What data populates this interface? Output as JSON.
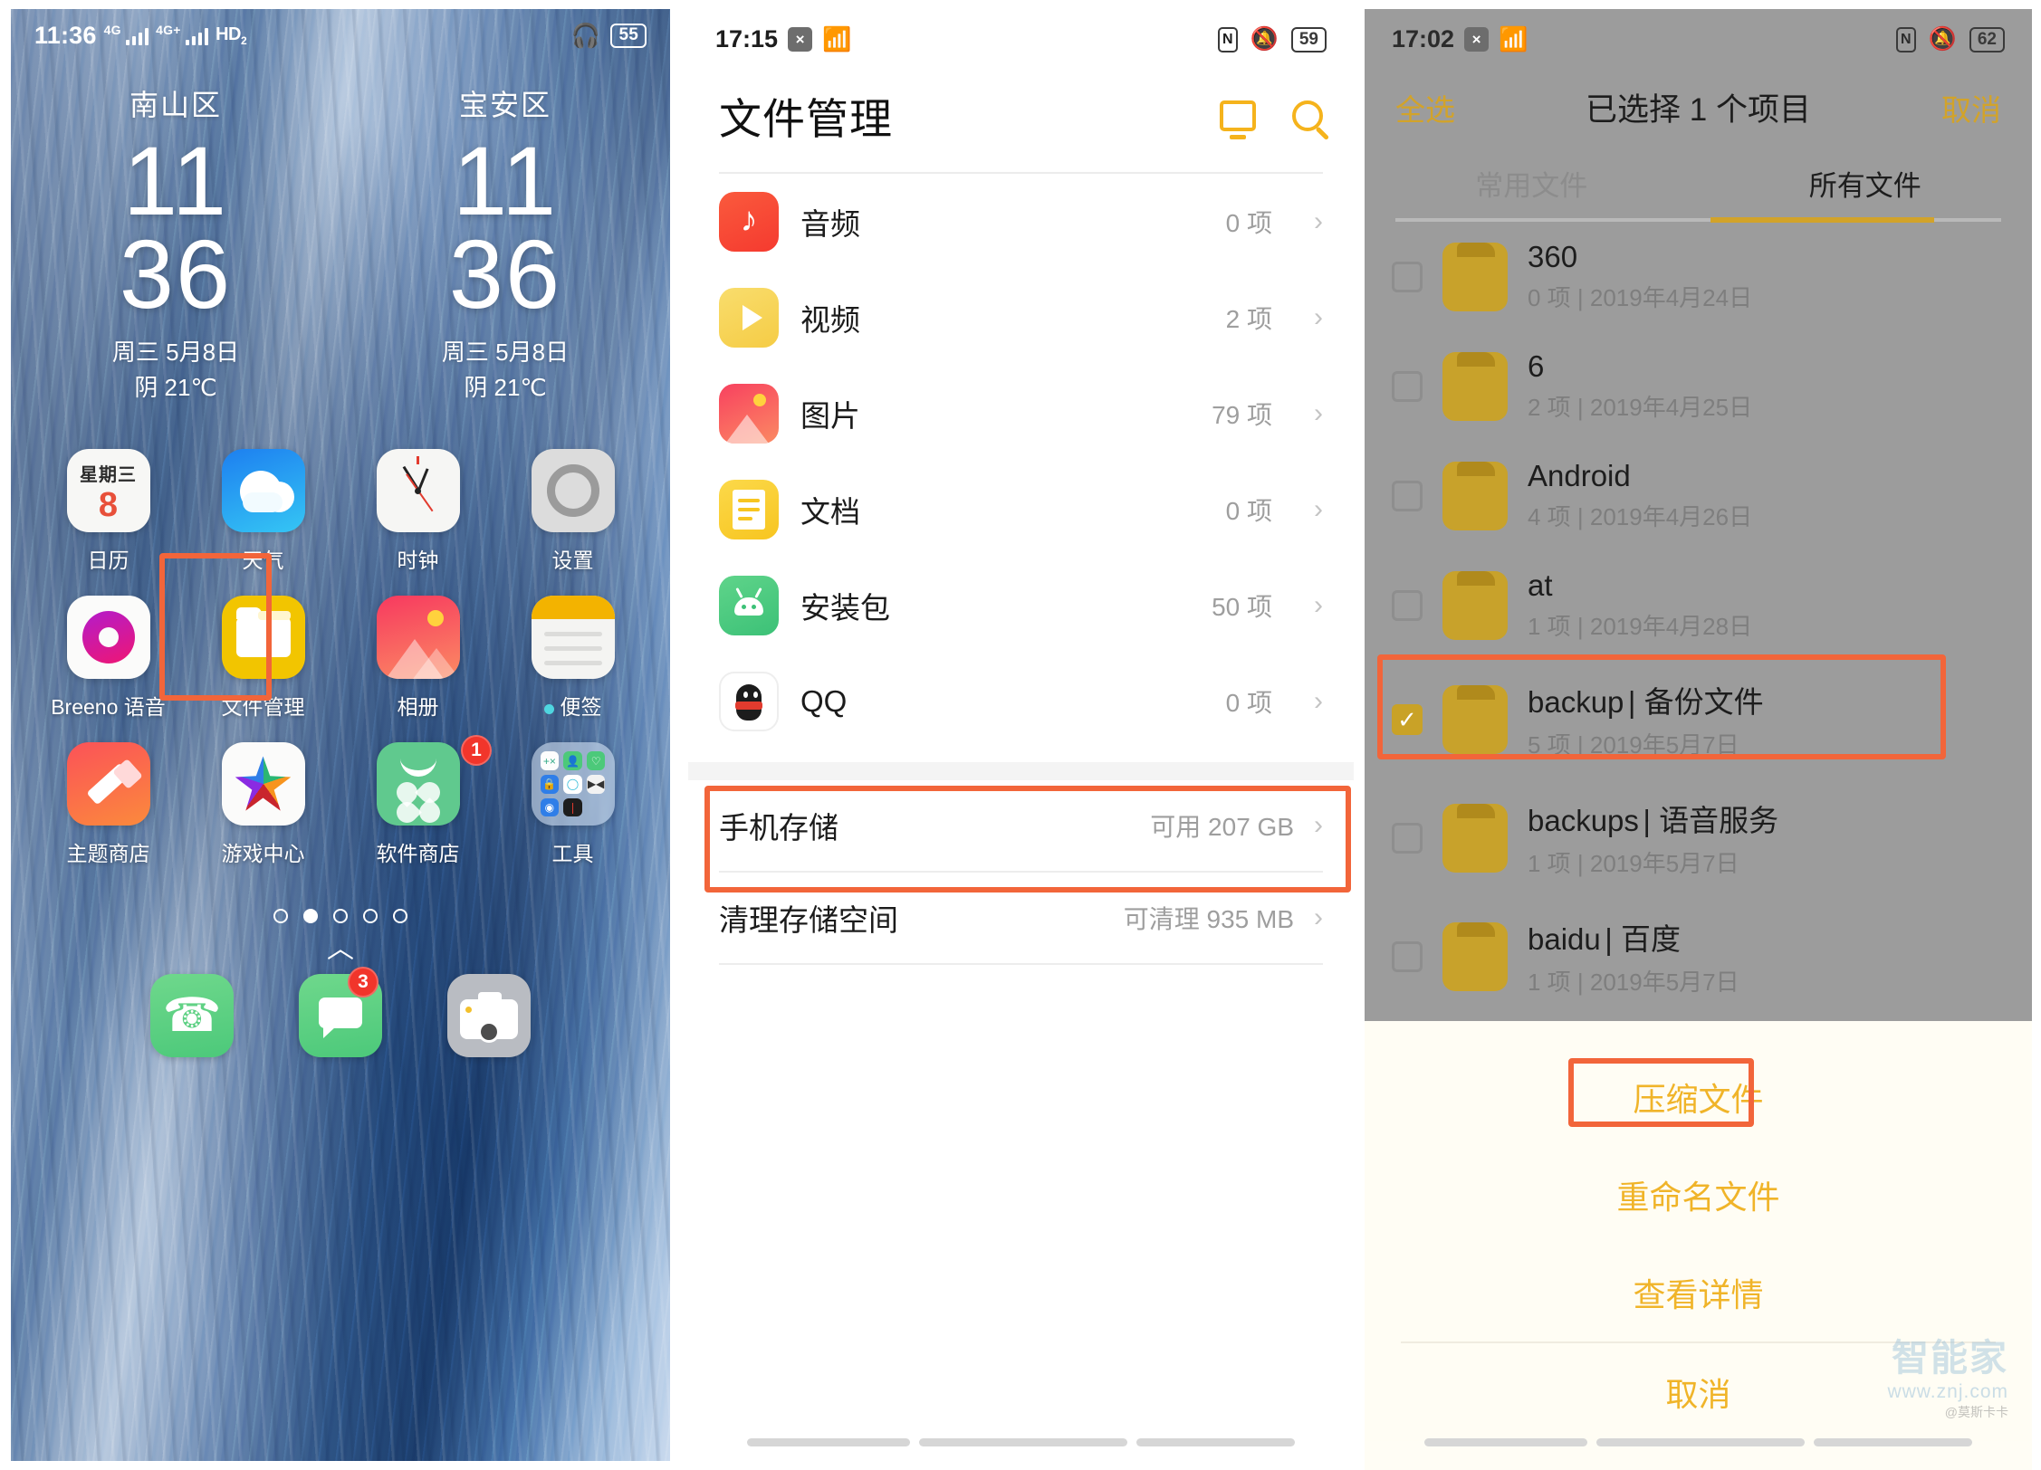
{
  "panel1": {
    "status_bar": {
      "time": "11:36",
      "signal_label_1": "4G",
      "signal_label_2": "4G+",
      "volte": "HD",
      "volte_sub": "2",
      "headset_icon": "headphones-icon",
      "battery": "55"
    },
    "clock_widgets": [
      {
        "city": "南山区",
        "hour": "11",
        "minute": "36",
        "date": "周三  5月8日",
        "weather": "阴 21℃"
      },
      {
        "city": "宝安区",
        "hour": "11",
        "minute": "36",
        "date": "周三  5月8日",
        "weather": "阴 21℃"
      }
    ],
    "apps": [
      {
        "label": "日历",
        "icon": "calendar-icon",
        "cal_weekday": "星期三",
        "cal_day": "8"
      },
      {
        "label": "天气",
        "icon": "weather-icon"
      },
      {
        "label": "时钟",
        "icon": "clock-icon"
      },
      {
        "label": "设置",
        "icon": "settings-gear-icon"
      },
      {
        "label": "Breeno 语音",
        "icon": "breeno-voice-icon"
      },
      {
        "label": "文件管理",
        "icon": "file-manager-folder-icon",
        "highlighted": true
      },
      {
        "label": "相册",
        "icon": "gallery-icon"
      },
      {
        "label": "便签",
        "icon": "notes-icon",
        "dot": true
      },
      {
        "label": "主题商店",
        "icon": "theme-store-brush-icon"
      },
      {
        "label": "游戏中心",
        "icon": "game-center-star-icon"
      },
      {
        "label": "软件商店",
        "icon": "app-store-icon",
        "badge": "1"
      },
      {
        "label": "工具",
        "icon": "tools-folder-icon"
      }
    ],
    "page_dots": {
      "count": 5,
      "active_index": 1
    },
    "up_chevron": "︿",
    "dock": [
      {
        "label": "电话",
        "icon": "phone-icon"
      },
      {
        "label": "信息",
        "icon": "messages-icon",
        "badge": "3"
      },
      {
        "label": "相机",
        "icon": "camera-icon"
      }
    ]
  },
  "panel2": {
    "status_bar": {
      "time": "17:15",
      "x_icon": "x-badge-icon",
      "wifi_icon": "wifi-icon",
      "nfc_icon": "nfc-icon",
      "nfc_label": "N",
      "mute_icon": "bell-mute-icon",
      "battery": "59"
    },
    "title": "文件管理",
    "actions": {
      "monitor_icon": "remote-display-icon",
      "search_icon": "search-icon"
    },
    "categories": [
      {
        "name": "音频",
        "count": "0 项",
        "icon": "audio-icon",
        "chevron": "chevron-right-icon"
      },
      {
        "name": "视频",
        "count": "2 项",
        "icon": "video-icon",
        "chevron": "chevron-right-icon"
      },
      {
        "name": "图片",
        "count": "79 项",
        "icon": "image-icon",
        "chevron": "chevron-right-icon"
      },
      {
        "name": "文档",
        "count": "0 项",
        "icon": "document-icon",
        "chevron": "chevron-right-icon"
      },
      {
        "name": "安装包",
        "count": "50 项",
        "icon": "apk-android-icon",
        "chevron": "chevron-right-icon"
      },
      {
        "name": "QQ",
        "count": "0 项",
        "icon": "qq-penguin-icon",
        "chevron": "chevron-right-icon"
      }
    ],
    "storage_row": {
      "name": "手机存储",
      "value": "可用 207 GB",
      "highlighted": true,
      "chevron": "chevron-right-icon"
    },
    "clean_row": {
      "name": "清理存储空间",
      "value": "可清理 935 MB",
      "chevron": "chevron-right-icon"
    }
  },
  "panel3": {
    "status_bar": {
      "time": "17:02",
      "x_icon": "x-badge-icon",
      "wifi_icon": "wifi-icon",
      "nfc_label": "N",
      "mute_icon": "bell-mute-icon",
      "battery": "62"
    },
    "select_all": "全选",
    "selection_title": "已选择 1 个项目",
    "cancel": "取消",
    "tabs": [
      {
        "label": "常用文件",
        "active": false
      },
      {
        "label": "所有文件",
        "active": true
      }
    ],
    "folders": [
      {
        "name": "360",
        "alias": "",
        "meta": "0 项 | 2019年4月24日",
        "checked": false,
        "highlighted": false
      },
      {
        "name": "6",
        "alias": "",
        "meta": "2 项 | 2019年4月25日",
        "checked": false,
        "highlighted": false
      },
      {
        "name": "Android",
        "alias": "",
        "meta": "4 项 | 2019年4月26日",
        "checked": false,
        "highlighted": false
      },
      {
        "name": "at",
        "alias": "",
        "meta": "1 项 | 2019年4月28日",
        "checked": false,
        "highlighted": false
      },
      {
        "name": "backup",
        "alias": "| 备份文件",
        "meta": "5 项 | 2019年5月7日",
        "checked": true,
        "highlighted": true
      },
      {
        "name": "backups",
        "alias": "| 语音服务",
        "meta": "1 项 | 2019年5月7日",
        "checked": false,
        "highlighted": false
      },
      {
        "name": "baidu",
        "alias": "| 百度",
        "meta": "1 项 | 2019年5月7日",
        "checked": false,
        "highlighted": false
      }
    ],
    "sheet_actions": [
      {
        "label": "压缩文件",
        "highlighted": true
      },
      {
        "label": "重命名文件",
        "highlighted": false
      },
      {
        "label": "查看详情",
        "highlighted": false
      }
    ],
    "sheet_cancel": "取消",
    "watermark": {
      "brand": "智能家",
      "url": "www.znj.com",
      "handle": "@莫斯卡卡"
    }
  },
  "colors": {
    "accent_yellow": "#f2b01c",
    "highlight_orange": "#f2653a",
    "folder_gold": "#c8a22b",
    "sheet_text": "#f0b429"
  }
}
